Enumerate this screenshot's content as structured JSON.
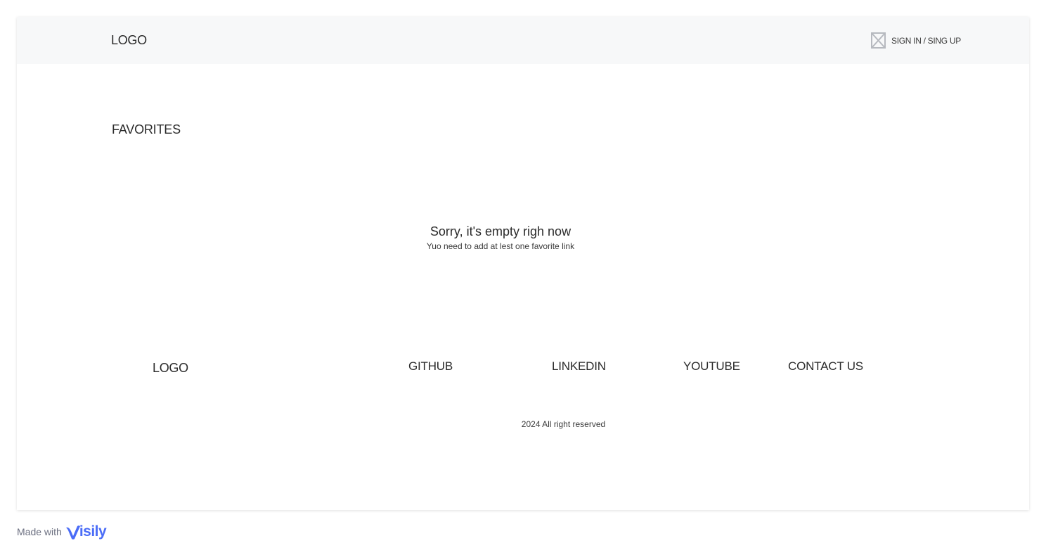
{
  "header": {
    "logo": "LOGO",
    "signin_label": "SIGN IN / SING UP",
    "signin_icon": "image-placeholder-icon"
  },
  "favorites": {
    "title": "FAVORITES",
    "empty_title": "Sorry,  it's empty righ now",
    "empty_subtitle": "Yuo need to add at lest one favorite link"
  },
  "footer": {
    "logo": "LOGO",
    "links": [
      {
        "label": "GITHUB"
      },
      {
        "label": "LINKEDIN"
      },
      {
        "label": "YOUTUBE"
      },
      {
        "label": "CONTACT US"
      }
    ],
    "copyright": "2024 All right reserved"
  },
  "badge": {
    "made_with": "Made with",
    "brand": "isily",
    "brand_color": "#4a6cf7"
  },
  "colors": {
    "header_bg": "#f7f8f9",
    "text": "#2b2b2b",
    "placeholder_icon": "#b6b9bf"
  }
}
